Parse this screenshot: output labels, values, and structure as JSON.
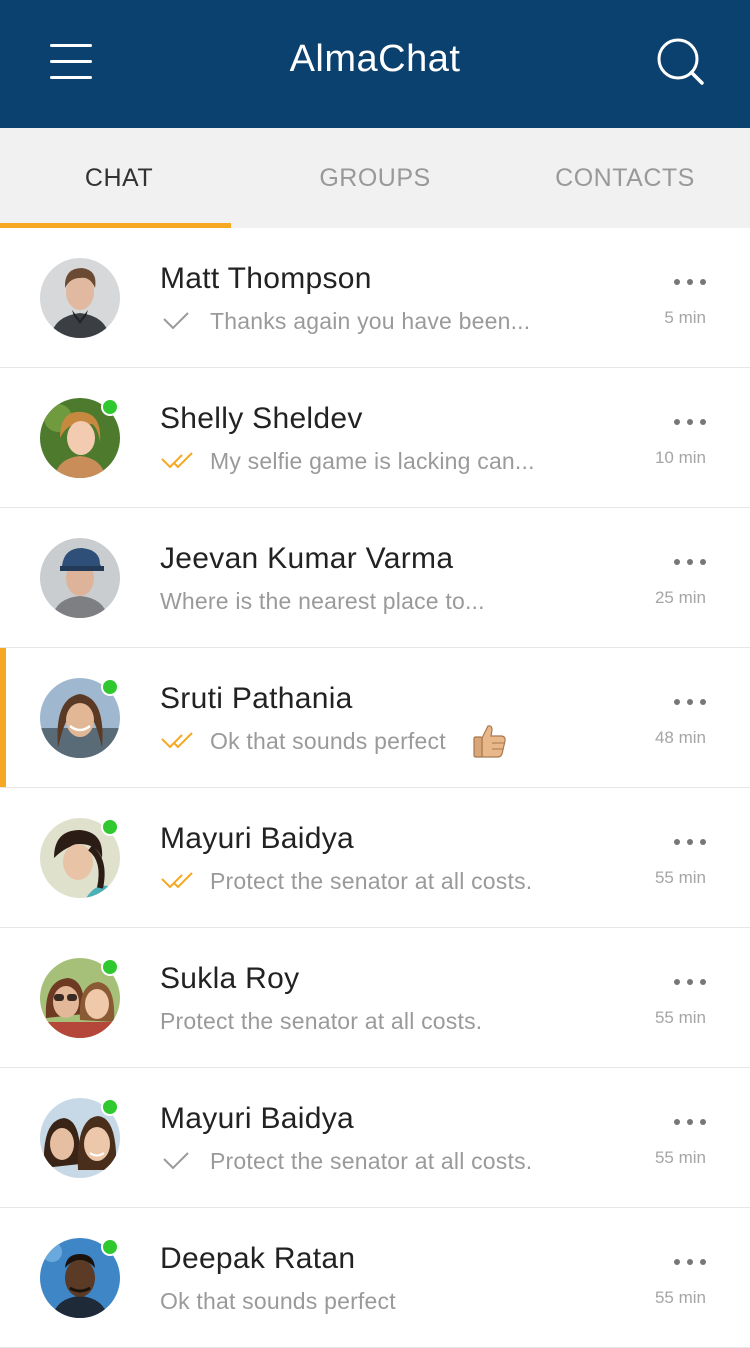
{
  "header": {
    "title": "AlmaChat",
    "menu_icon": "hamburger-menu-icon",
    "search_icon": "search-icon",
    "background_color": "#0b416f"
  },
  "tabs": [
    {
      "label": "CHAT",
      "active": true
    },
    {
      "label": "GROUPS",
      "active": false
    },
    {
      "label": "CONTACTS",
      "active": false
    }
  ],
  "accent_color": "#f7a823",
  "online_color": "#2fc82f",
  "chats": [
    {
      "name": "Matt Thompson",
      "message": "Thanks again you have been...",
      "time": "5 min",
      "status": "sent",
      "online": false,
      "selected": false
    },
    {
      "name": "Shelly Sheldev",
      "message": "My selfie game is lacking can...",
      "time": "10 min",
      "status": "read",
      "online": true,
      "selected": false
    },
    {
      "name": "Jeevan Kumar Varma",
      "message": "Where is the nearest place to...",
      "time": "25 min",
      "status": "none",
      "online": false,
      "selected": false
    },
    {
      "name": "Sruti Pathania",
      "message": "Ok that sounds perfect",
      "time": "48 min",
      "status": "read",
      "online": true,
      "selected": true,
      "emoji": "thumbs-up-icon"
    },
    {
      "name": "Mayuri Baidya",
      "message": "Protect the senator at all costs.",
      "time": "55 min",
      "status": "read",
      "online": true,
      "selected": false
    },
    {
      "name": "Sukla Roy",
      "message": "Protect the senator at all costs.",
      "time": "55 min",
      "status": "none",
      "online": true,
      "selected": false
    },
    {
      "name": "Mayuri Baidya",
      "message": "Protect the senator at all costs.",
      "time": "55 min",
      "status": "sent",
      "online": true,
      "selected": false
    },
    {
      "name": "Deepak Ratan",
      "message": "Ok that sounds perfect",
      "time": "55 min",
      "status": "none",
      "online": true,
      "selected": false
    }
  ]
}
